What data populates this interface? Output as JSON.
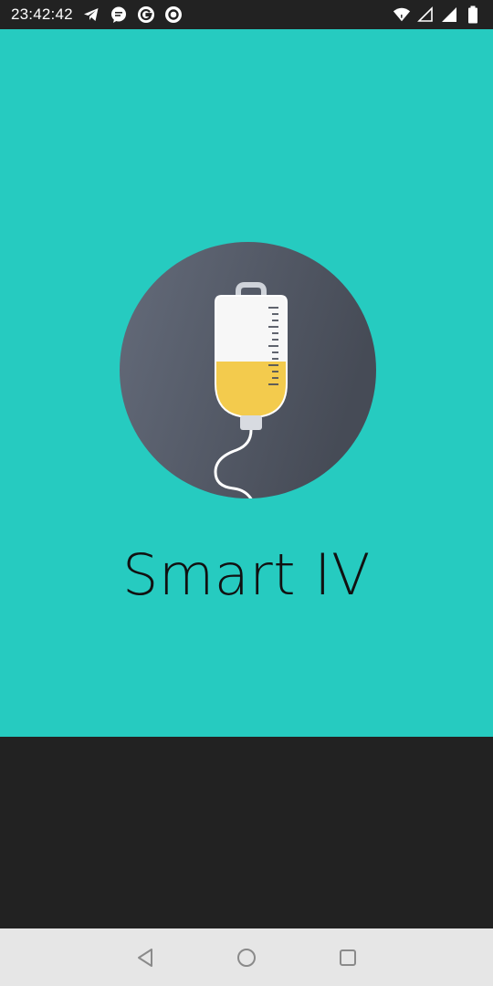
{
  "status_bar": {
    "time": "23:42:42",
    "left_icons": [
      "telegram-icon",
      "chat-bubble-icon",
      "g-circle-icon",
      "ring-icon"
    ],
    "right_icons": [
      "wifi-icon",
      "signal-empty-icon",
      "signal-full-icon",
      "battery-icon"
    ]
  },
  "splash": {
    "background": "#26cbc0",
    "app_name": "Smart IV",
    "logo_icon": "iv-bag-icon"
  },
  "nav_bar": {
    "buttons": [
      "back-icon",
      "home-icon",
      "recents-icon"
    ]
  }
}
